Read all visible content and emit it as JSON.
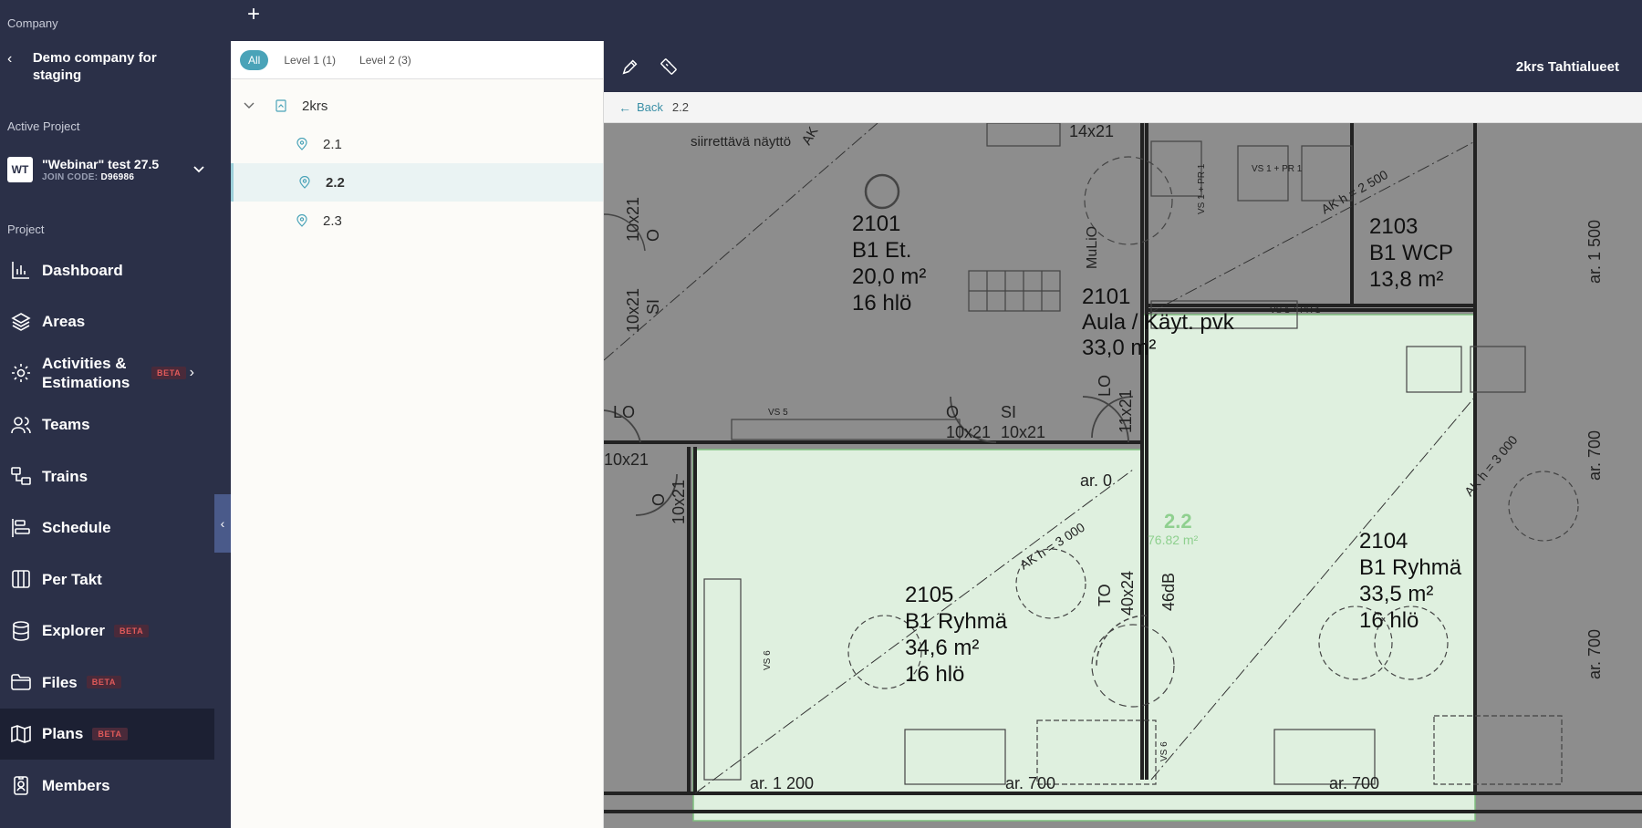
{
  "sidebar": {
    "company_label": "Company",
    "company_name": "Demo company for staging",
    "active_project_label": "Active Project",
    "project": {
      "badge": "WT",
      "name": "\"Webinar\" test 27.5",
      "join_code_label": "JOIN CODE:",
      "join_code": "D96986"
    },
    "project_label": "Project",
    "items": [
      {
        "label": "Dashboard",
        "icon": "chart-bar-icon"
      },
      {
        "label": "Areas",
        "icon": "layers-icon"
      },
      {
        "label": "Activities & Estimations",
        "icon": "gear-icon",
        "badge": "BETA"
      },
      {
        "label": "Teams",
        "icon": "people-icon"
      },
      {
        "label": "Trains",
        "icon": "train-icon"
      },
      {
        "label": "Schedule",
        "icon": "schedule-icon"
      },
      {
        "label": "Per Takt",
        "icon": "columns-icon"
      },
      {
        "label": "Explorer",
        "icon": "database-icon",
        "badge": "BETA"
      },
      {
        "label": "Files",
        "icon": "folder-icon",
        "badge": "BETA"
      },
      {
        "label": "Plans",
        "icon": "map-icon",
        "badge": "BETA",
        "active": true
      },
      {
        "label": "Members",
        "icon": "badge-icon"
      }
    ]
  },
  "area_panel": {
    "filters": [
      {
        "label": "All",
        "active": true
      },
      {
        "label": "Level 1 (1)"
      },
      {
        "label": "Level 2 (3)"
      }
    ],
    "tree": {
      "root": "2krs",
      "children": [
        {
          "label": "2.1"
        },
        {
          "label": "2.2",
          "selected": true
        },
        {
          "label": "2.3"
        }
      ]
    }
  },
  "plan": {
    "title": "2krs Tahtialueet",
    "back_label": "Back",
    "crumb": "2.2",
    "area_label": "2.2",
    "area_size": "76.82 m²",
    "highlight_color": "#dff0df",
    "rooms": [
      {
        "num": "2101",
        "name": "B1 Et.",
        "area": "20,0  m²",
        "persons": "16 hlö"
      },
      {
        "num": "2101",
        "name": "Aula / Käyt. pvk",
        "area": "33,0  m²"
      },
      {
        "num": "2103",
        "name": "B1 WCP",
        "area": "13,8  m²"
      },
      {
        "num": "2105",
        "name": "B1 Ryhmä",
        "area": "34,6  m²",
        "persons": "16  hlö"
      },
      {
        "num": "2104",
        "name": "B1 Ryhmä",
        "area": "33,5  m²",
        "persons": "16  hlö"
      }
    ],
    "labels": {
      "siirrettava": "siirrettävä näyttö",
      "ak1": "AK",
      "ak_h2500": "AK    h = 2 500",
      "ak_h3000a": "AK    h = 3 000",
      "ak_h3000b": "AK    h = 3 000",
      "door_14x21": "14x21",
      "door_10x21a": "10x21",
      "door_10x21b": "10x21",
      "door_10x21c": "10x21",
      "door_10x21d": "10x21",
      "door_10x21e": "10x21",
      "door_10x21f": "10x21",
      "door_11x21": "11x21",
      "door_40x24": "40x24",
      "si1": "SI",
      "si2": "SI",
      "lo1": "LO",
      "lo2": "LO",
      "o1": "O",
      "o2": "O",
      "o3": "O",
      "to": "TO",
      "mulio": "MuLiO",
      "db46": "46dB",
      "ar0": "ar. 0",
      "ar1200": "ar. 1 200",
      "ar700a": "ar. 700",
      "ar700b": "ar. 700",
      "ar700c": "ar. 700",
      "ar700d": "ar. 700",
      "ar1500": "ar. 1 500",
      "vs5": "VS 5",
      "vs6a": "VS 6",
      "vs6b": "VS 6",
      "vspr1a": "VS 1 + PR 1",
      "vspr1b": "VS 1 + PR 1",
      "vspr1c": "VS 1 + PR 1"
    }
  }
}
